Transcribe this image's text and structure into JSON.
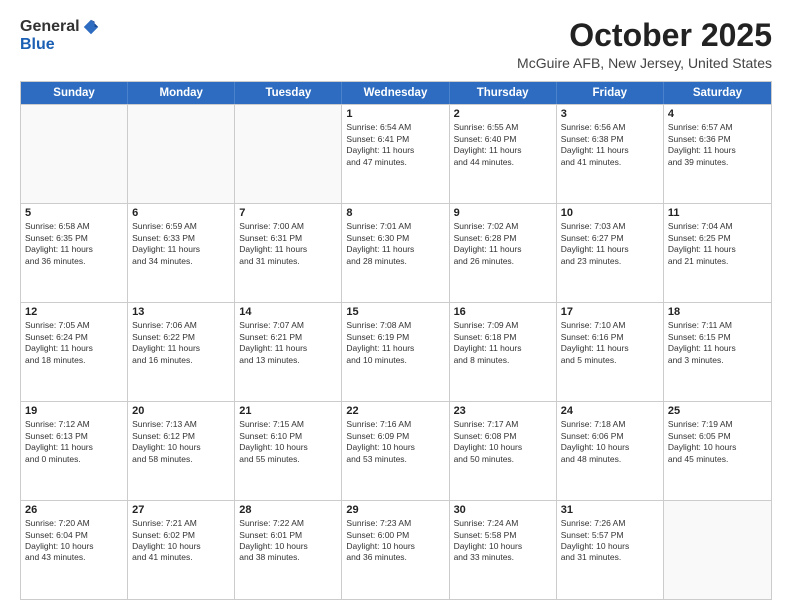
{
  "header": {
    "logo_general": "General",
    "logo_blue": "Blue",
    "month_title": "October 2025",
    "location": "McGuire AFB, New Jersey, United States"
  },
  "days_of_week": [
    "Sunday",
    "Monday",
    "Tuesday",
    "Wednesday",
    "Thursday",
    "Friday",
    "Saturday"
  ],
  "weeks": [
    [
      {
        "date": "",
        "info": ""
      },
      {
        "date": "",
        "info": ""
      },
      {
        "date": "",
        "info": ""
      },
      {
        "date": "1",
        "info": "Sunrise: 6:54 AM\nSunset: 6:41 PM\nDaylight: 11 hours\nand 47 minutes."
      },
      {
        "date": "2",
        "info": "Sunrise: 6:55 AM\nSunset: 6:40 PM\nDaylight: 11 hours\nand 44 minutes."
      },
      {
        "date": "3",
        "info": "Sunrise: 6:56 AM\nSunset: 6:38 PM\nDaylight: 11 hours\nand 41 minutes."
      },
      {
        "date": "4",
        "info": "Sunrise: 6:57 AM\nSunset: 6:36 PM\nDaylight: 11 hours\nand 39 minutes."
      }
    ],
    [
      {
        "date": "5",
        "info": "Sunrise: 6:58 AM\nSunset: 6:35 PM\nDaylight: 11 hours\nand 36 minutes."
      },
      {
        "date": "6",
        "info": "Sunrise: 6:59 AM\nSunset: 6:33 PM\nDaylight: 11 hours\nand 34 minutes."
      },
      {
        "date": "7",
        "info": "Sunrise: 7:00 AM\nSunset: 6:31 PM\nDaylight: 11 hours\nand 31 minutes."
      },
      {
        "date": "8",
        "info": "Sunrise: 7:01 AM\nSunset: 6:30 PM\nDaylight: 11 hours\nand 28 minutes."
      },
      {
        "date": "9",
        "info": "Sunrise: 7:02 AM\nSunset: 6:28 PM\nDaylight: 11 hours\nand 26 minutes."
      },
      {
        "date": "10",
        "info": "Sunrise: 7:03 AM\nSunset: 6:27 PM\nDaylight: 11 hours\nand 23 minutes."
      },
      {
        "date": "11",
        "info": "Sunrise: 7:04 AM\nSunset: 6:25 PM\nDaylight: 11 hours\nand 21 minutes."
      }
    ],
    [
      {
        "date": "12",
        "info": "Sunrise: 7:05 AM\nSunset: 6:24 PM\nDaylight: 11 hours\nand 18 minutes."
      },
      {
        "date": "13",
        "info": "Sunrise: 7:06 AM\nSunset: 6:22 PM\nDaylight: 11 hours\nand 16 minutes."
      },
      {
        "date": "14",
        "info": "Sunrise: 7:07 AM\nSunset: 6:21 PM\nDaylight: 11 hours\nand 13 minutes."
      },
      {
        "date": "15",
        "info": "Sunrise: 7:08 AM\nSunset: 6:19 PM\nDaylight: 11 hours\nand 10 minutes."
      },
      {
        "date": "16",
        "info": "Sunrise: 7:09 AM\nSunset: 6:18 PM\nDaylight: 11 hours\nand 8 minutes."
      },
      {
        "date": "17",
        "info": "Sunrise: 7:10 AM\nSunset: 6:16 PM\nDaylight: 11 hours\nand 5 minutes."
      },
      {
        "date": "18",
        "info": "Sunrise: 7:11 AM\nSunset: 6:15 PM\nDaylight: 11 hours\nand 3 minutes."
      }
    ],
    [
      {
        "date": "19",
        "info": "Sunrise: 7:12 AM\nSunset: 6:13 PM\nDaylight: 11 hours\nand 0 minutes."
      },
      {
        "date": "20",
        "info": "Sunrise: 7:13 AM\nSunset: 6:12 PM\nDaylight: 10 hours\nand 58 minutes."
      },
      {
        "date": "21",
        "info": "Sunrise: 7:15 AM\nSunset: 6:10 PM\nDaylight: 10 hours\nand 55 minutes."
      },
      {
        "date": "22",
        "info": "Sunrise: 7:16 AM\nSunset: 6:09 PM\nDaylight: 10 hours\nand 53 minutes."
      },
      {
        "date": "23",
        "info": "Sunrise: 7:17 AM\nSunset: 6:08 PM\nDaylight: 10 hours\nand 50 minutes."
      },
      {
        "date": "24",
        "info": "Sunrise: 7:18 AM\nSunset: 6:06 PM\nDaylight: 10 hours\nand 48 minutes."
      },
      {
        "date": "25",
        "info": "Sunrise: 7:19 AM\nSunset: 6:05 PM\nDaylight: 10 hours\nand 45 minutes."
      }
    ],
    [
      {
        "date": "26",
        "info": "Sunrise: 7:20 AM\nSunset: 6:04 PM\nDaylight: 10 hours\nand 43 minutes."
      },
      {
        "date": "27",
        "info": "Sunrise: 7:21 AM\nSunset: 6:02 PM\nDaylight: 10 hours\nand 41 minutes."
      },
      {
        "date": "28",
        "info": "Sunrise: 7:22 AM\nSunset: 6:01 PM\nDaylight: 10 hours\nand 38 minutes."
      },
      {
        "date": "29",
        "info": "Sunrise: 7:23 AM\nSunset: 6:00 PM\nDaylight: 10 hours\nand 36 minutes."
      },
      {
        "date": "30",
        "info": "Sunrise: 7:24 AM\nSunset: 5:58 PM\nDaylight: 10 hours\nand 33 minutes."
      },
      {
        "date": "31",
        "info": "Sunrise: 7:26 AM\nSunset: 5:57 PM\nDaylight: 10 hours\nand 31 minutes."
      },
      {
        "date": "",
        "info": ""
      }
    ]
  ]
}
